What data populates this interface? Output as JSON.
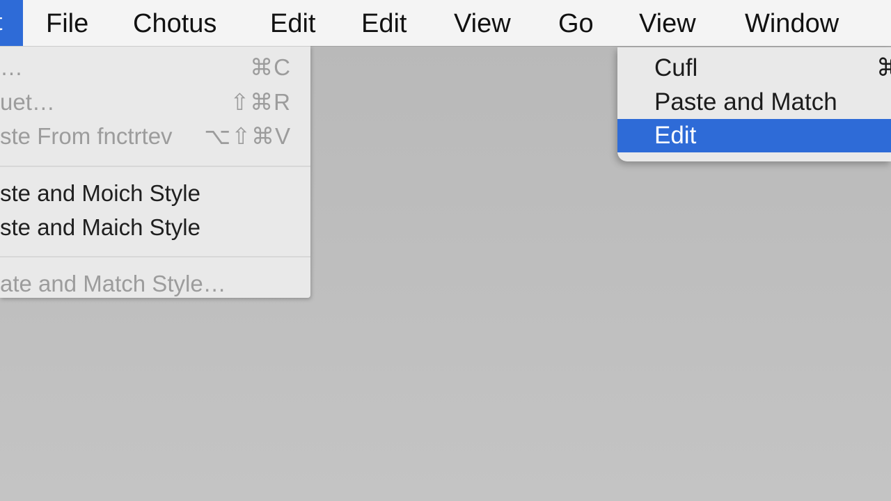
{
  "menubar": {
    "active_fragment": "t",
    "items": [
      {
        "label": "File"
      },
      {
        "label": "Chotus"
      },
      {
        "label": "Edit"
      },
      {
        "label": "Edit"
      },
      {
        "label": "View"
      },
      {
        "label": "Go"
      },
      {
        "label": "View"
      },
      {
        "label": "Window"
      }
    ]
  },
  "left_menu": {
    "items": [
      {
        "label": "…",
        "shortcut": "⌘C",
        "enabled": false
      },
      {
        "label": "uet…",
        "shortcut": "⇧⌘R",
        "enabled": false
      },
      {
        "label": "ste From fnctrtev",
        "shortcut": "⌥⇧⌘V",
        "enabled": false
      },
      {
        "label": "ste and Moich Style",
        "enabled": true
      },
      {
        "label": "ste and Maich Style",
        "enabled": true
      },
      {
        "label": "ate and Match Style…",
        "enabled": false
      }
    ]
  },
  "right_menu": {
    "items": [
      {
        "label": "Cufl",
        "shortcut": "⌘",
        "highlighted": false
      },
      {
        "label": "Paste and Match",
        "highlighted": false
      },
      {
        "label": "Edit",
        "highlighted": true
      }
    ]
  },
  "colors": {
    "highlight": "#2e6bd7",
    "menu_bg": "#e9e9e9",
    "menubar_bg": "#f4f4f4",
    "desktop_bg": "#bdbdbd",
    "disabled_text": "#9c9c9c"
  }
}
